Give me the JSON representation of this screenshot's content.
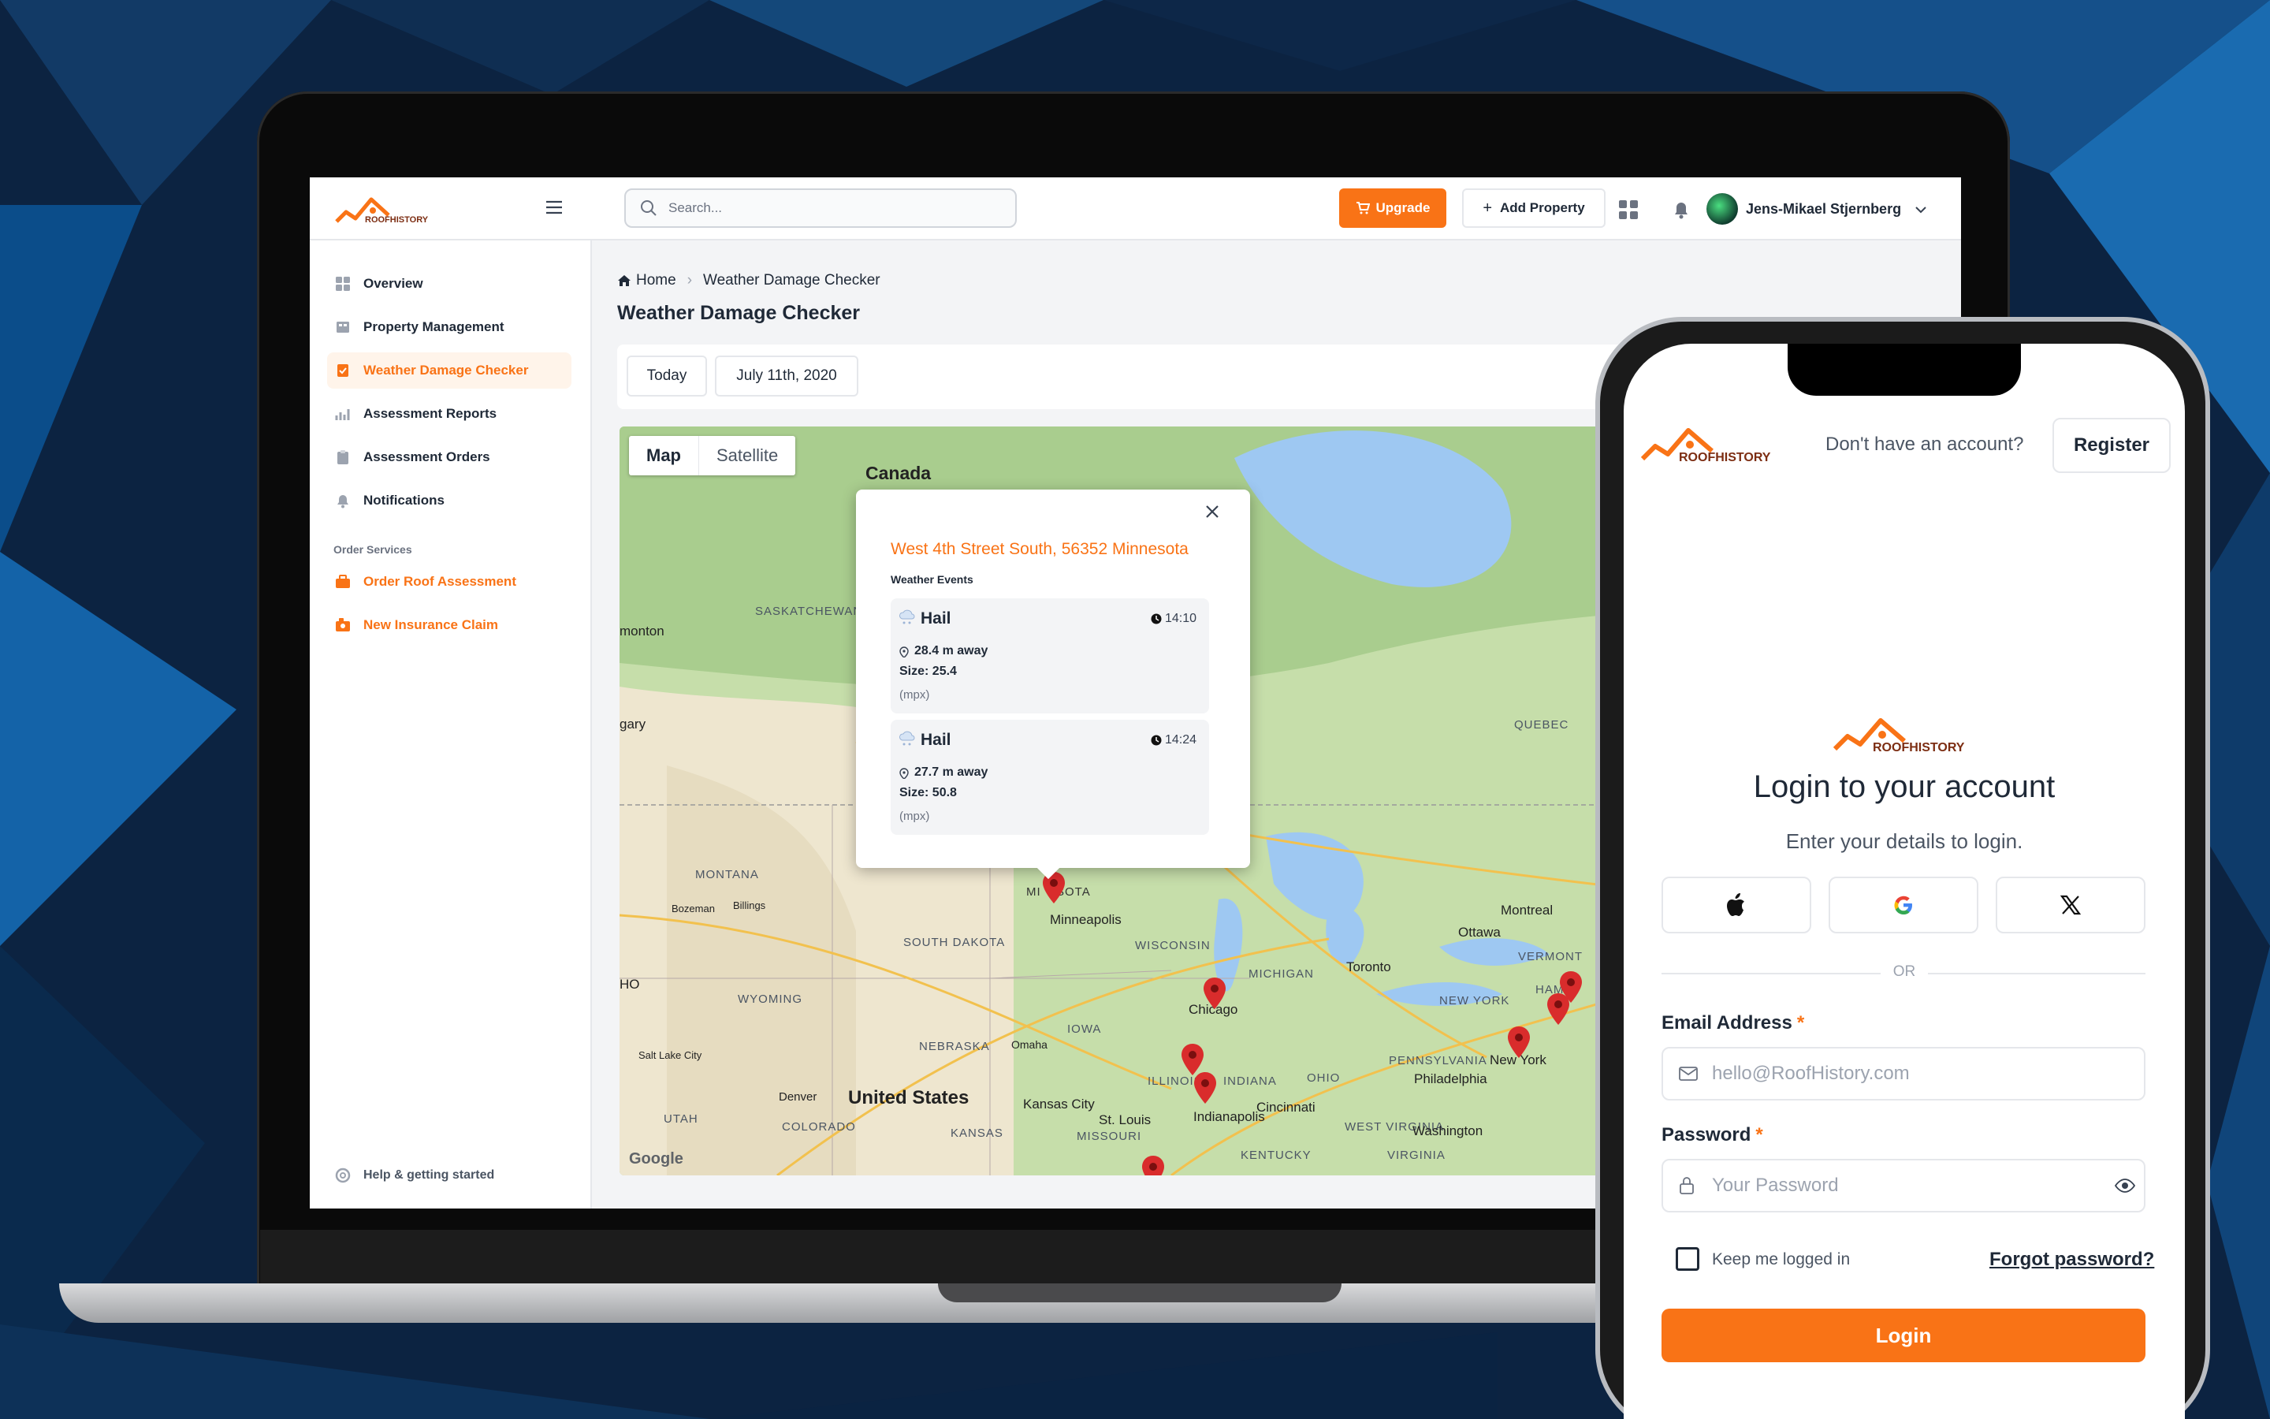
{
  "colors": {
    "accent": "#f97316",
    "pin": "#d92c2c",
    "background": "#0d2444"
  },
  "laptop": {
    "brand": "ROOFHISTORY",
    "search_placeholder": "Search...",
    "upgrade_label": "Upgrade",
    "add_property_label": "Add Property",
    "user_name": "Jens-Mikael Stjernberg",
    "nav": [
      {
        "label": "Overview",
        "icon": "grid-icon"
      },
      {
        "label": "Property Management",
        "icon": "building-icon"
      },
      {
        "label": "Weather Damage Checker",
        "icon": "checklist-icon",
        "active": true
      },
      {
        "label": "Assessment Reports",
        "icon": "chart-icon"
      },
      {
        "label": "Assessment Orders",
        "icon": "clipboard-icon"
      },
      {
        "label": "Notifications",
        "icon": "bell-icon"
      }
    ],
    "order_services_heading": "Order Services",
    "order_services": [
      {
        "label": "Order Roof Assessment",
        "icon": "briefcase-icon"
      },
      {
        "label": "New Insurance Claim",
        "icon": "claim-icon"
      }
    ],
    "help_label": "Help & getting started",
    "breadcrumb": {
      "home": "Home",
      "current": "Weather Damage Checker"
    },
    "page_title": "Weather Damage Checker",
    "date_chips": [
      "Today",
      "July 11th, 2020"
    ],
    "map": {
      "tabs": [
        "Map",
        "Satellite"
      ],
      "popup": {
        "address": "West 4th Street South, 56352 Minnesota",
        "events_heading": "Weather Events",
        "events": [
          {
            "type": "Hail",
            "time": "14:10",
            "distance": "28.4 m away",
            "size": "Size: 25.4",
            "unit": "(mpx)"
          },
          {
            "type": "Hail",
            "time": "14:24",
            "distance": "27.7 m away",
            "size": "Size: 50.8",
            "unit": "(mpx)"
          }
        ]
      },
      "labels": {
        "canada": "Canada",
        "united_states": "United States",
        "saskatchewan": "SASKATCHEWAN",
        "montana": "MONTANA",
        "south_dakota": "SOUTH DAKOTA",
        "wyoming": "WYOMING",
        "nebraska": "NEBRASKA",
        "utah": "UTAH",
        "colorado": "COLORADO",
        "kansas": "KANSAS",
        "iowa": "IOWA",
        "wisconsin": "WISCONSIN",
        "michigan": "MICHIGAN",
        "illinois": "ILLINOIS",
        "indiana": "INDIANA",
        "ohio": "OHIO",
        "missouri": "MISSOURI",
        "kentucky": "KENTUCKY",
        "west_virginia": "WEST VIRGINIA",
        "virginia": "VIRGINIA",
        "pennsylvania": "PENNSYLVANIA",
        "new_york": "NEW YORK",
        "vermont": "VERMONT",
        "quebec": "QUEBEC",
        "ho": "HO",
        "hamp": "HAMP",
        "monton": "monton",
        "gary": "gary",
        "minnesota_pre": "MI",
        "minnesota_post": "SOTA",
        "bozeman": "Bozeman",
        "billings": "Billings",
        "minneapolis": "Minneapolis",
        "omaha": "Omaha",
        "salt_lake_city": "Salt Lake City",
        "denver": "Denver",
        "kansas_city": "Kansas City",
        "st_louis": "St. Louis",
        "chicago": "Chicago",
        "indianapolis": "Indianapolis",
        "cincinnati": "Cincinnati",
        "toronto": "Toronto",
        "ottawa": "Ottawa",
        "montreal": "Montreal",
        "new_york_city": "New York",
        "philadelphia": "Philadelphia",
        "washington": "Washington",
        "google": "Google"
      }
    }
  },
  "phone": {
    "brand": "ROOFHISTORY",
    "no_account_text": "Don't have an account?",
    "register_label": "Register",
    "title": "Login to your account",
    "subtitle": "Enter your details to login.",
    "divider": "OR",
    "email_label": "Email Address",
    "email_placeholder": "hello@RoofHistory.com",
    "password_label": "Password",
    "password_placeholder": "Your Password",
    "required_mark": "*",
    "keep_logged_in": "Keep me logged in",
    "forgot_password": "Forgot password?",
    "login_label": "Login"
  }
}
